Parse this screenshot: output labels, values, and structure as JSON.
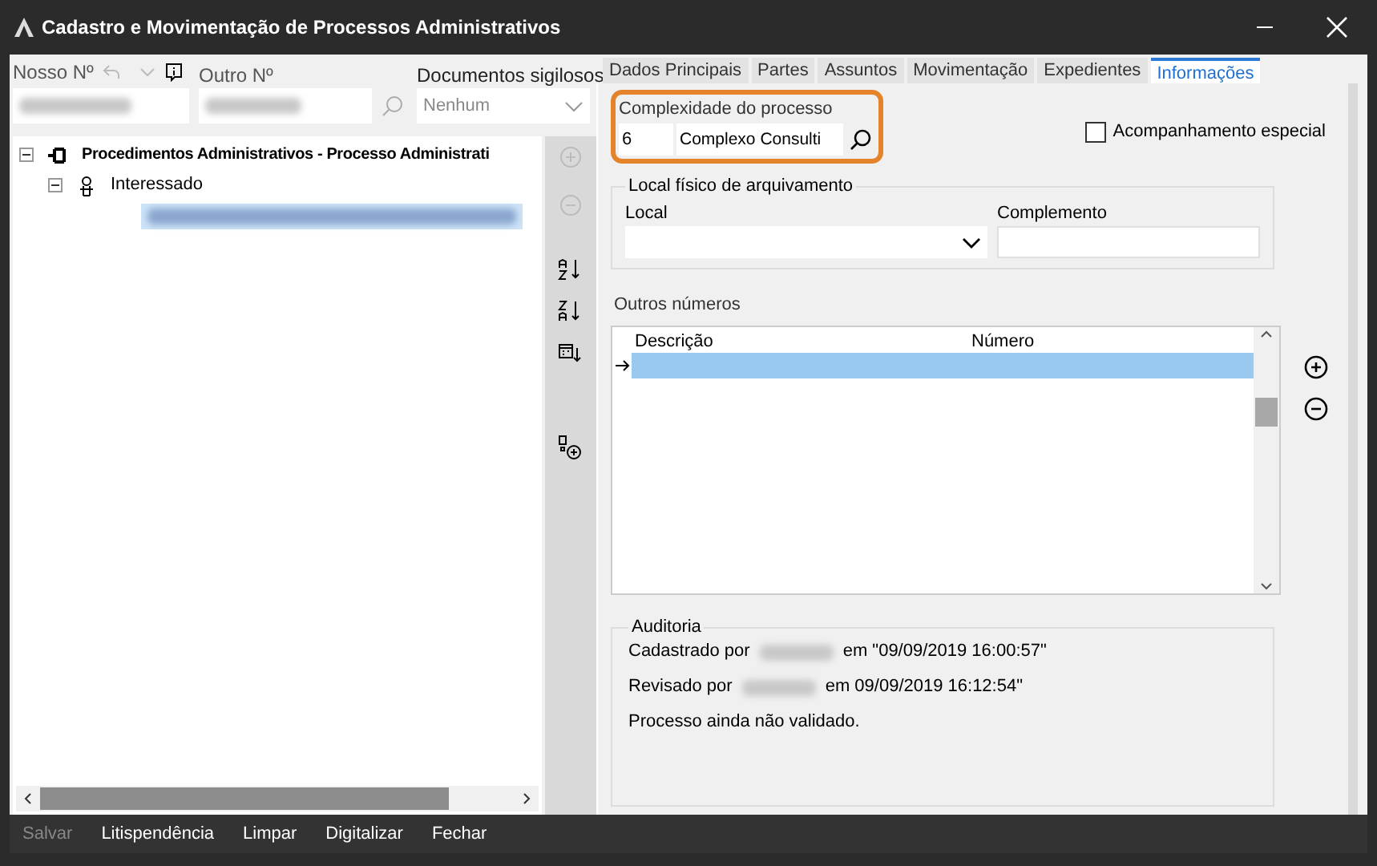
{
  "window": {
    "title": "Cadastro e Movimentação de Processos Administrativos"
  },
  "header": {
    "nosso_label": "Nosso Nº",
    "outro_label": "Outro Nº",
    "sigilosos_label": "Documentos sigilosos",
    "sigilosos_value": "Nenhum"
  },
  "tree": [
    {
      "kind": "process",
      "label": "Procedimentos Administrativos - Processo Administrati",
      "expanded": true,
      "children": [
        {
          "kind": "person",
          "label": "Interessado",
          "expanded": true,
          "children": [
            {
              "kind": "redacted"
            }
          ]
        }
      ]
    }
  ],
  "tabs": [
    {
      "label": "Dados Principais",
      "selected": false
    },
    {
      "label": "Partes",
      "selected": false
    },
    {
      "label": "Assuntos",
      "selected": false
    },
    {
      "label": "Movimentação",
      "selected": false
    },
    {
      "label": "Expedientes",
      "selected": false
    },
    {
      "label": "Informações",
      "selected": true
    }
  ],
  "complexidade": {
    "label": "Complexidade do processo",
    "code": "6",
    "value": "Complexo Consulti"
  },
  "acompanhamento": {
    "label": "Acompanhamento especial",
    "checked": false
  },
  "local_fisico": {
    "title": "Local físico de arquivamento",
    "local_label": "Local",
    "complemento_label": "Complemento"
  },
  "outros_numeros": {
    "title": "Outros números",
    "columns": [
      "Descrição",
      "Número"
    ],
    "rows": [
      {
        "selected": true,
        "current": true
      }
    ]
  },
  "auditoria": {
    "title": "Auditoria",
    "lines": [
      {
        "before": "Cadastrado por",
        "after": "em \"09/09/2019 16:00:57\""
      },
      {
        "before": "Revisado por",
        "after": "em 09/09/2019 16:12:54\""
      },
      {
        "before": "Processo ainda não validado."
      }
    ]
  },
  "buttons": [
    {
      "label": "Salvar",
      "disabled": true
    },
    {
      "label": "Litispendência",
      "disabled": false
    },
    {
      "label": "Limpar",
      "disabled": false
    },
    {
      "label": "Digitalizar",
      "disabled": false
    },
    {
      "label": "Fechar",
      "disabled": false
    }
  ]
}
